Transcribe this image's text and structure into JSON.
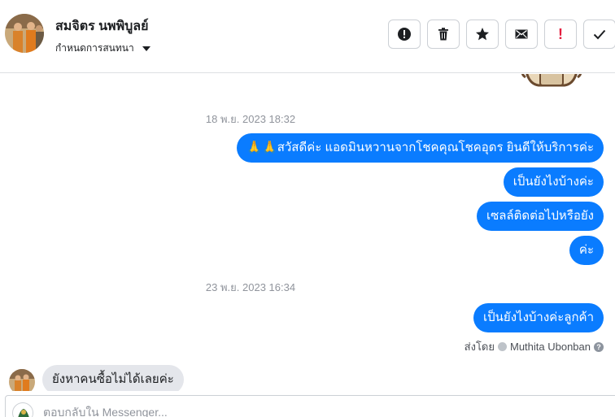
{
  "header": {
    "contact_name": "สมจิตร นพพิบูลย์",
    "assign_label": "กำหนดการสนทนา"
  },
  "toolbar": {
    "buttons": [
      {
        "name": "alert",
        "icon": "alert-circle-icon"
      },
      {
        "name": "delete",
        "icon": "trash-icon"
      },
      {
        "name": "star",
        "icon": "star-icon"
      },
      {
        "name": "mail",
        "icon": "envelope-icon"
      },
      {
        "name": "mark-important",
        "label": "!"
      },
      {
        "name": "done",
        "icon": "checkmark-icon"
      }
    ]
  },
  "thread": {
    "timestamp_1": "18 พ.ย. 2023 18:32",
    "timestamp_2": "23 พ.ย. 2023 16:34",
    "outgoing": [
      "🙏🙏สวัสดีค่ะ แอดมินหวานจากโชคคุณโชคอุดร ยินดีให้บริการค่ะ",
      "เป็นยังไงบ้างค่ะ",
      "เซลล์ติดต่อไปหรือยัง",
      "ค่ะ",
      "เป็นยังไงบ้างค่ะลูกค้า"
    ],
    "sent_by_prefix": "ส่งโดย",
    "sent_by_name": "Muthita Ubonban",
    "incoming": [
      "ยังหาคนซื้อไม่ได้เลยค่ะ"
    ]
  },
  "composer": {
    "placeholder": "ตอบกลับใน Messenger..."
  },
  "colors": {
    "outgoing_bubble": "#0a7cff",
    "incoming_bubble": "#e4e6eb",
    "important": "#e41e3f"
  }
}
